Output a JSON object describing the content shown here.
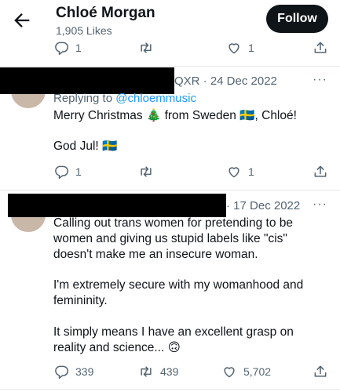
{
  "header": {
    "title": "Chloé Morgan",
    "subtitle": "1,905 Likes",
    "follow_label": "Follow"
  },
  "tweet0": {
    "reply_count": "1",
    "like_count": "1"
  },
  "reply1": {
    "handle_suffix": "QXR · 24 Dec 2022",
    "replying_prefix": "Replying to ",
    "replying_handle": "@chloemmusic",
    "line1": "Merry Christmas 🎄 from Sweden 🇸🇪, Chloé!",
    "line2": "God Jul! 🇸🇪",
    "reply_count": "1",
    "like_count": "1"
  },
  "reply2": {
    "date": "· 17 Dec 2022",
    "para1": "Calling out trans women for pretending to be women and giving us stupid labels like \"cis\" doesn't make me an insecure woman.",
    "para2": "I'm extremely secure with my womanhood and femininity.",
    "para3": "It simply means I have an excellent grasp on reality and science... 🙃",
    "reply_count": "339",
    "retweet_count": "439",
    "like_count": "5,702"
  },
  "more_glyph": "···",
  "icons": [
    "back-arrow-icon",
    "reply-icon",
    "retweet-icon",
    "like-icon",
    "share-icon",
    "more-icon"
  ]
}
